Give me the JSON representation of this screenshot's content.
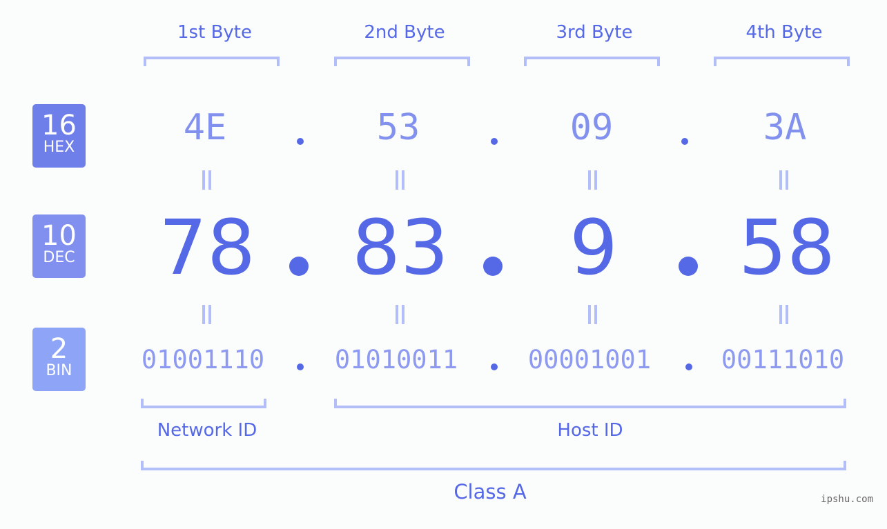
{
  "badges": [
    {
      "num": "16",
      "label": "HEX",
      "color": "#6f7fe9"
    },
    {
      "num": "10",
      "label": "DEC",
      "color": "#8190ee"
    },
    {
      "num": "2",
      "label": "BIN",
      "color": "#8ea5f7"
    }
  ],
  "byte_headers": [
    "1st Byte",
    "2nd Byte",
    "3rd Byte",
    "4th Byte"
  ],
  "hex": [
    "4E",
    "53",
    "09",
    "3A"
  ],
  "dec": [
    "78",
    "83",
    "9",
    "58"
  ],
  "bin": [
    "01001110",
    "01010011",
    "00001001",
    "00111010"
  ],
  "labels": {
    "network": "Network ID",
    "host": "Host ID",
    "class": "Class A"
  },
  "watermark": "ipshu.com"
}
